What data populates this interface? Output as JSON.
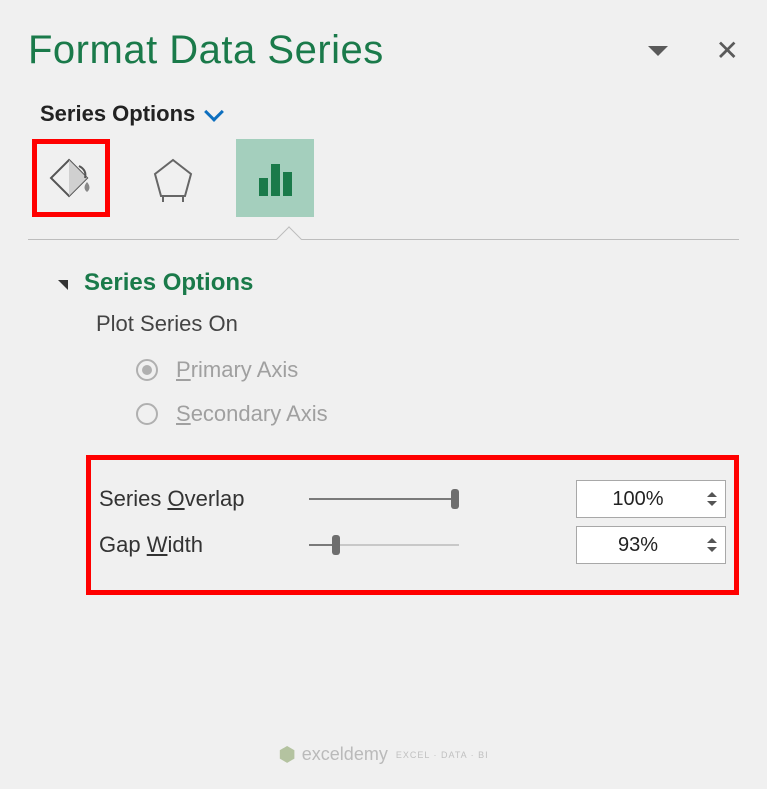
{
  "header": {
    "title": "Format Data Series"
  },
  "tabs": {
    "heading": "Series Options",
    "fill_icon": "paint-bucket-icon",
    "effects_icon": "pentagon-icon",
    "chart_icon": "bar-chart-icon"
  },
  "section": {
    "title": "Series Options",
    "plot_on_label": "Plot Series On",
    "primary_prefix": "P",
    "primary_rest": "rimary Axis",
    "secondary_prefix": "S",
    "secondary_rest": "econdary Axis"
  },
  "sliders": {
    "overlap_pre": "Series ",
    "overlap_u": "O",
    "overlap_post": "verlap",
    "overlap_value": "100%",
    "overlap_pct": 100,
    "gap_pre": "Gap ",
    "gap_u": "W",
    "gap_post": "idth",
    "gap_value": "93%",
    "gap_pct": 18
  },
  "watermark": {
    "text": "exceldemy",
    "sub": "EXCEL · DATA · BI"
  }
}
